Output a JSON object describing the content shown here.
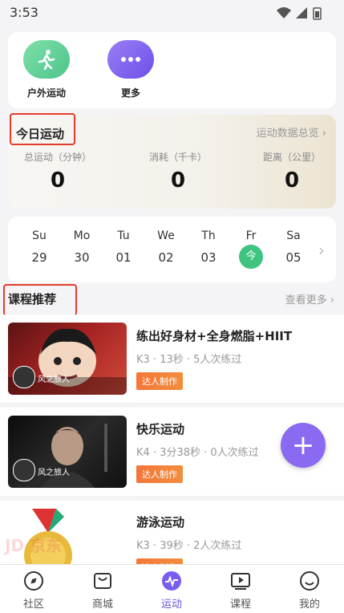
{
  "status_bar": {
    "time": "3:53"
  },
  "quick_actions": [
    {
      "label": "户外运动",
      "icon": "running-person-icon",
      "color": "#5ccc94"
    },
    {
      "label": "更多",
      "icon": "more-dots-icon",
      "color": "#7b5cf0"
    }
  ],
  "today": {
    "title": "今日运动",
    "link": "运动数据总览 ›",
    "stats": [
      {
        "label": "总运动（分钟）",
        "value": "0"
      },
      {
        "label": "消耗（千卡）",
        "value": "0"
      },
      {
        "label": "距离（公里）",
        "value": "0"
      }
    ]
  },
  "week": {
    "days": [
      {
        "name": "Su",
        "num": "29"
      },
      {
        "name": "Mo",
        "num": "30"
      },
      {
        "name": "Tu",
        "num": "01"
      },
      {
        "name": "We",
        "num": "02"
      },
      {
        "name": "Th",
        "num": "03"
      },
      {
        "name": "Fr",
        "num": "今"
      },
      {
        "name": "Sa",
        "num": "05"
      }
    ],
    "today_color": "#3ec47e"
  },
  "courses_section": {
    "title": "课程推荐",
    "more": "查看更多 ›"
  },
  "courses": [
    {
      "name": "练出好身材+全身燃脂+HIIT",
      "meta": "K3 · 13秒 · 5人次练过",
      "tag": "达人制作",
      "uploader": "风之旅人"
    },
    {
      "name": "快乐运动",
      "meta": "K4 · 3分38秒 · 0人次练过",
      "tag": "达人制作",
      "uploader": "风之旅人"
    },
    {
      "name": "游泳运动",
      "meta": "K3 · 39秒 · 2人次练过",
      "tag": "达人制作",
      "uploader": ""
    }
  ],
  "fab": {
    "label": "+",
    "color": "#8a6af0"
  },
  "watermark": "JD 京东",
  "tabbar": [
    {
      "label": "社区",
      "icon": "compass-icon"
    },
    {
      "label": "商城",
      "icon": "shopping-bag-icon"
    },
    {
      "label": "运动",
      "icon": "pulse-icon"
    },
    {
      "label": "课程",
      "icon": "video-play-icon"
    },
    {
      "label": "我的",
      "icon": "smiley-icon"
    }
  ],
  "accent_color": "#6a4fd8"
}
